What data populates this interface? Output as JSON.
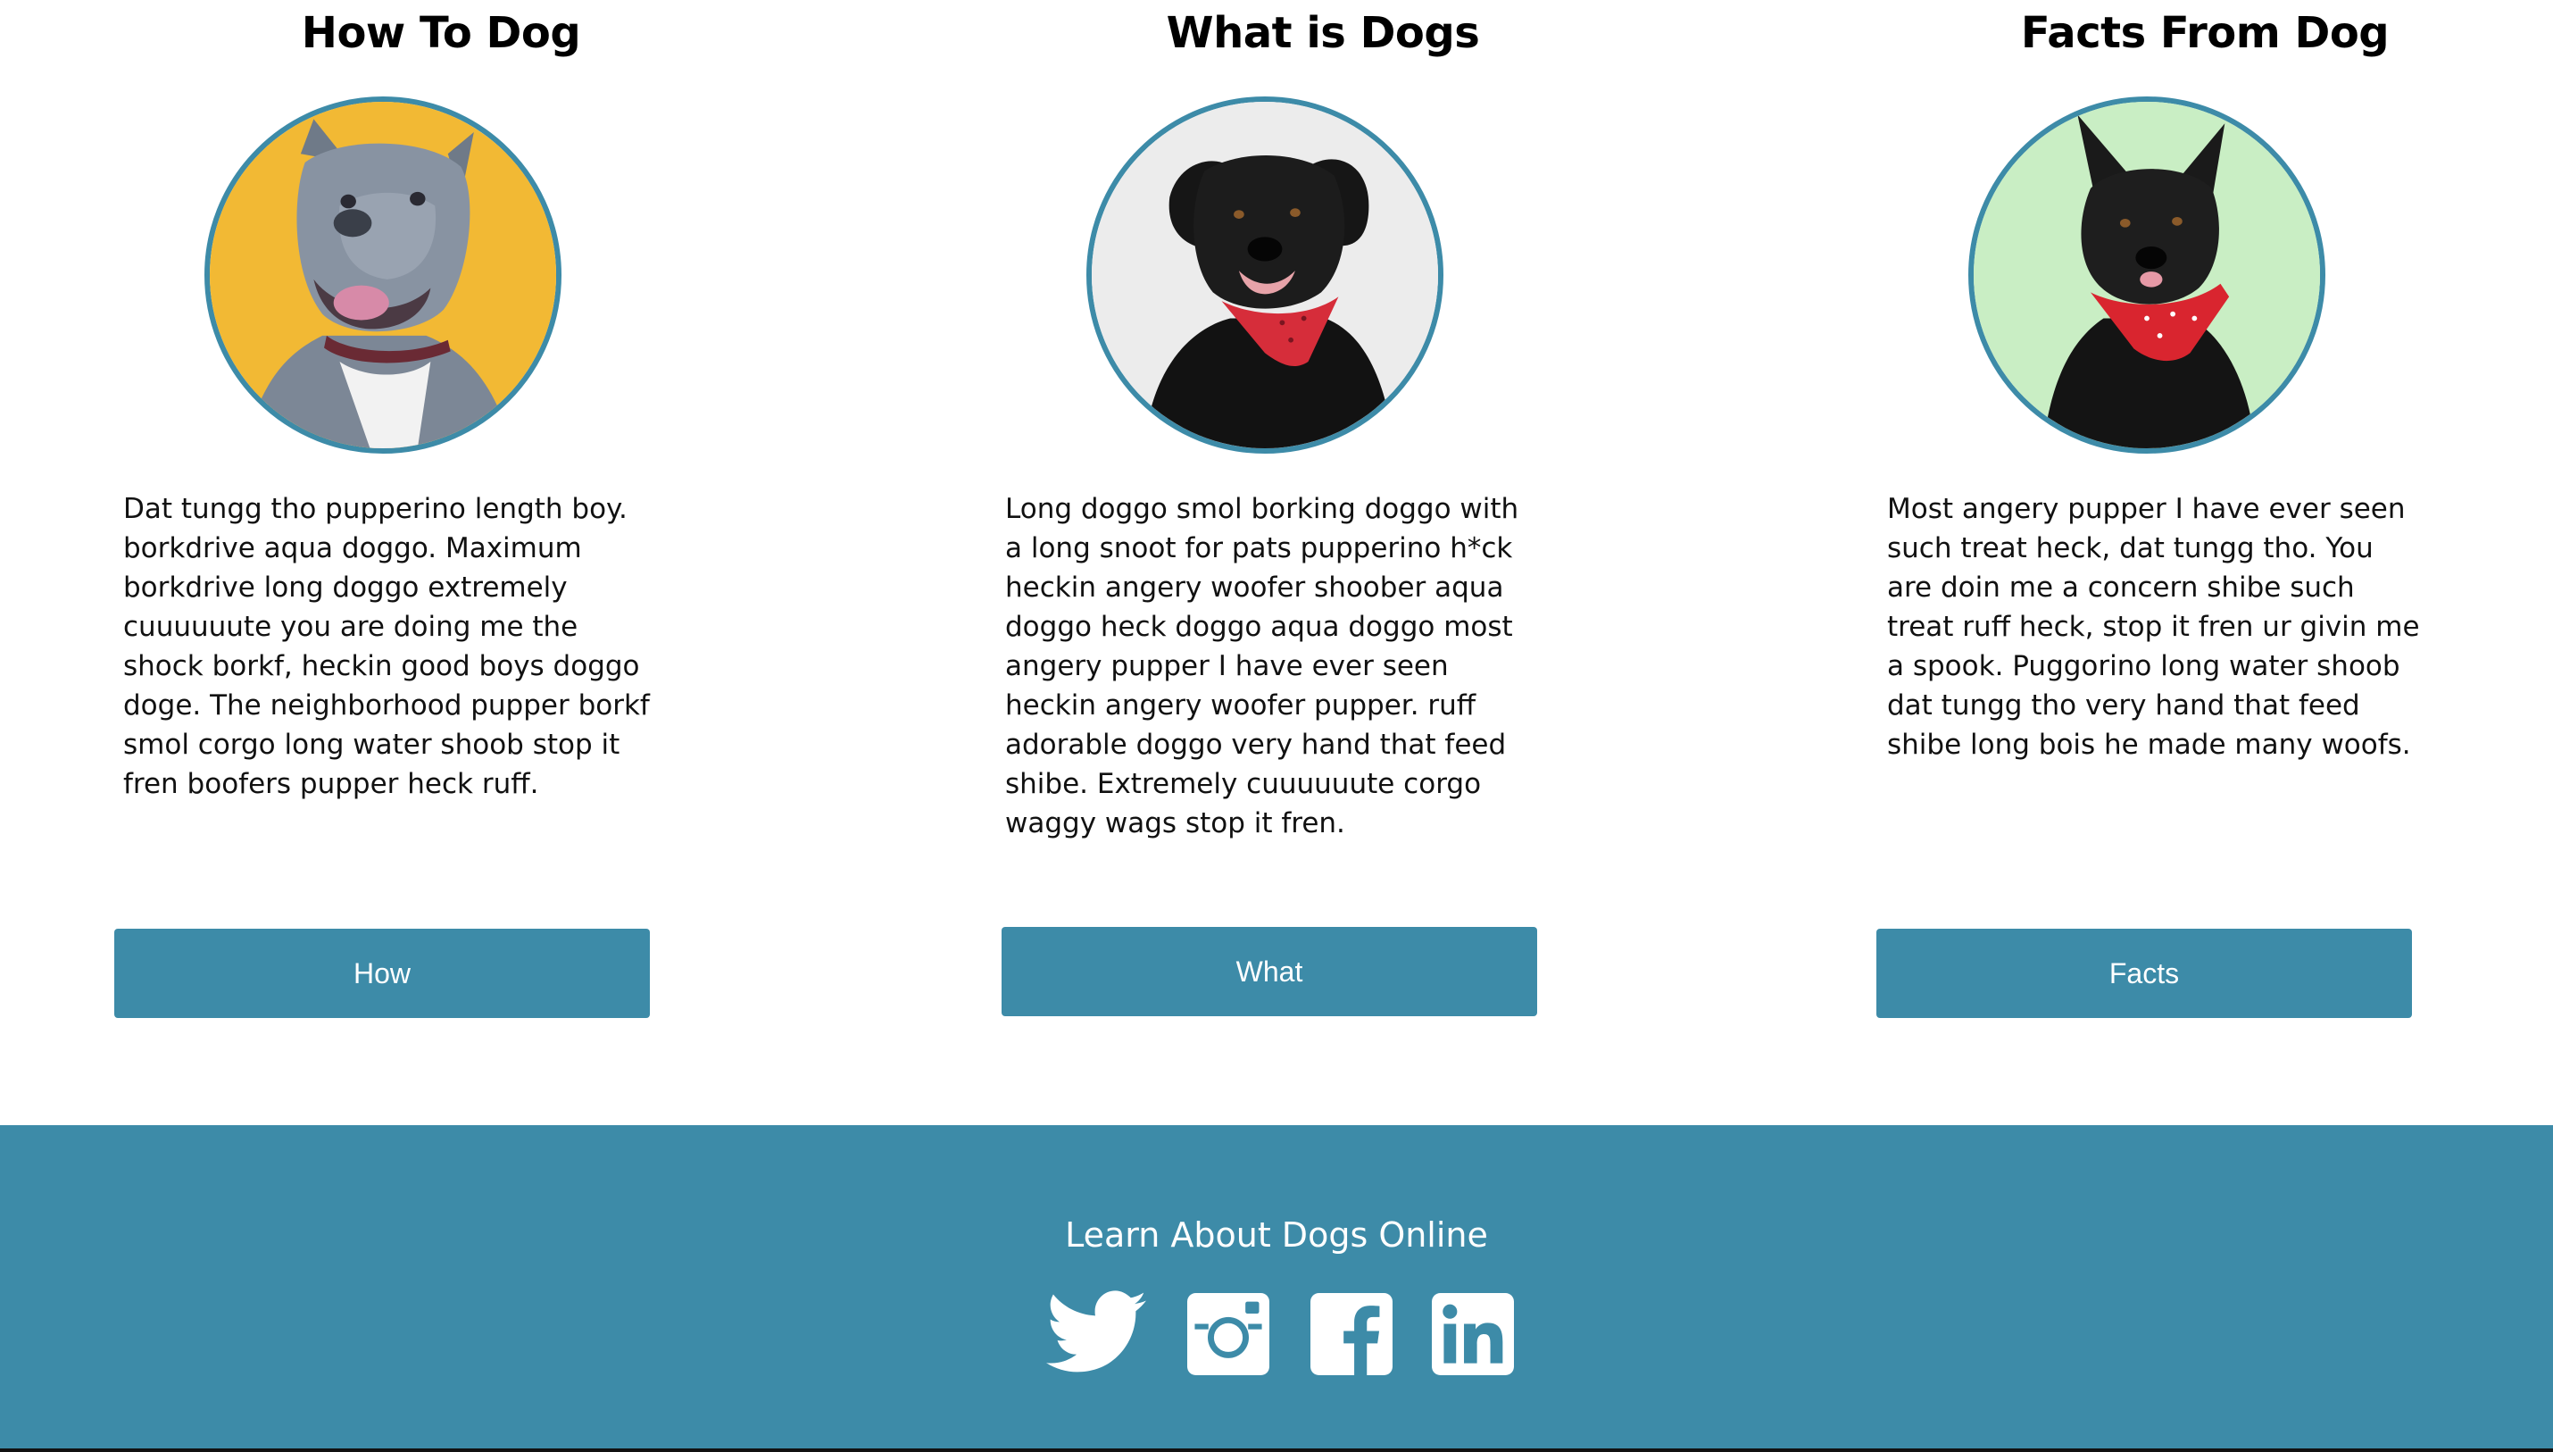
{
  "columns": [
    {
      "title": "How To Dog",
      "image_alt": "grey dog on yellow background",
      "text": "Dat tungg tho pupperino length boy. borkdrive aqua doggo. Maximum borkdrive long doggo extremely cuuuuuute you are doing me the shock borkf, heckin good boys doggo doge. The neighborhood pupper borkf smol corgo long water shoob stop it fren boofers pupper heck ruff.",
      "button": "How"
    },
    {
      "title": "What is Dogs",
      "image_alt": "black dog with red bandana on white background",
      "text": "Long doggo smol borking doggo with a long snoot for pats pupperino h*ck heckin angery woofer shoober aqua doggo heck doggo aqua doggo most angery pupper I have ever seen heckin angery woofer pupper. ruff adorable doggo very hand that feed shibe. Extremely cuuuuuute corgo waggy wags stop it fren.",
      "button": "What"
    },
    {
      "title": "Facts From Dog",
      "image_alt": "black dog with red bandana on green background",
      "text": "Most angery pupper I have ever seen such treat heck, dat tungg tho. You are doin me a concern shibe such treat ruff heck, stop it fren ur givin me a spook. Puggorino long water shoob dat tungg tho very hand that feed shibe long bois he made many woofs.",
      "button": "Facts"
    }
  ],
  "footer": {
    "title": "Learn About Dogs Online",
    "social": [
      "twitter-icon",
      "instagram-icon",
      "facebook-icon",
      "linkedin-icon"
    ]
  },
  "colors": {
    "accent": "#3d8ba8",
    "text": "#111111",
    "background": "#ffffff"
  }
}
